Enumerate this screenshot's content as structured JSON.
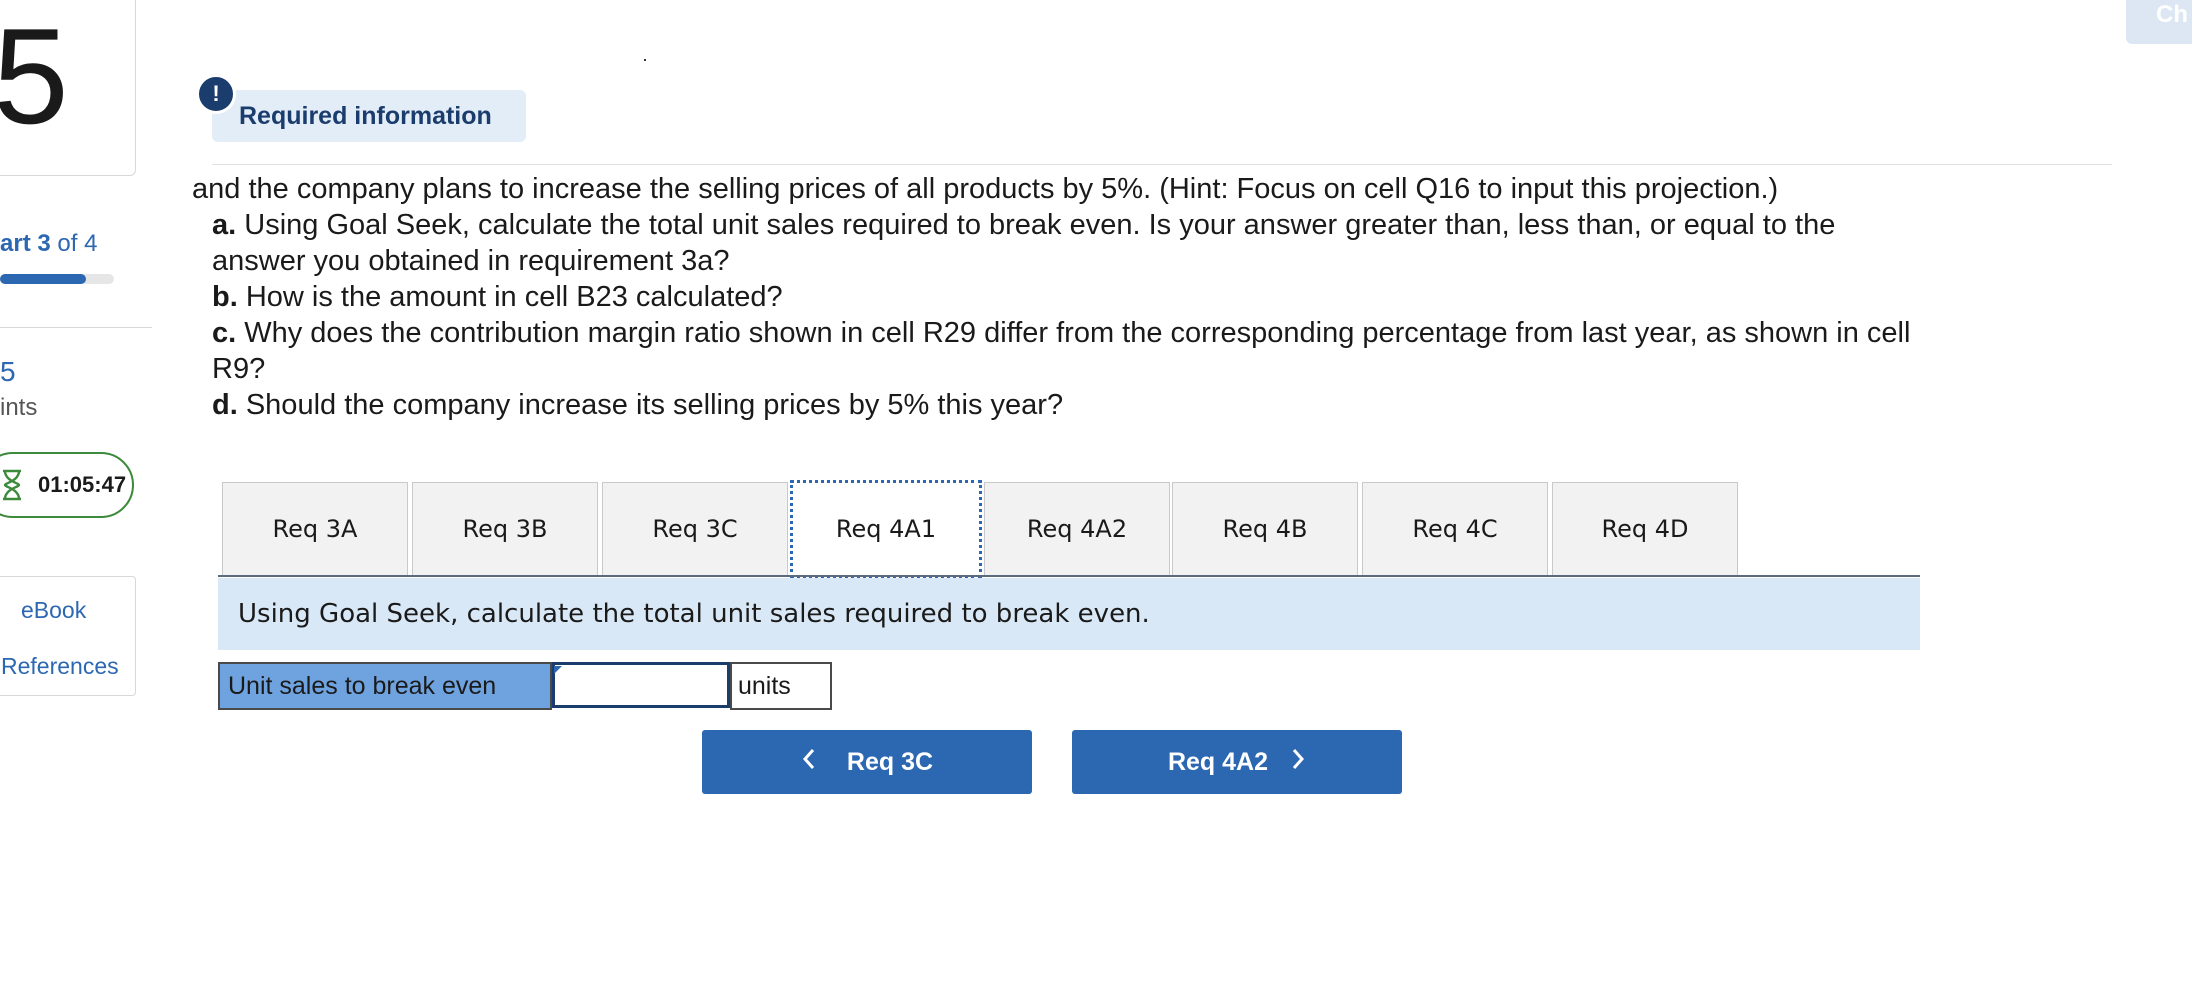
{
  "sidebar": {
    "question_number": "5",
    "part_word": "art",
    "part_current": "3",
    "part_of": "of 4",
    "part_progress": 0.75,
    "points_value": "5",
    "points_label": "ints",
    "timer": "01:05:47",
    "links": [
      "eBook",
      "References"
    ]
  },
  "top_right_button": "Ch",
  "required_info": {
    "icon": "!",
    "label": "Required information"
  },
  "question": {
    "lead": "and the company plans to increase the selling prices of all products by 5%. (Hint: Focus on cell Q16 to input this projection.)",
    "items": [
      {
        "letter": "a.",
        "text": " Using Goal Seek, calculate the total unit sales required to break even. Is your answer greater than, less than, or equal to the",
        "cont": "answer you obtained in requirement 3a?"
      },
      {
        "letter": "b.",
        "text": " How is the amount in cell B23 calculated?",
        "cont": ""
      },
      {
        "letter": "c.",
        "text": " Why does the contribution margin ratio shown in cell R29 differ from the corresponding percentage from last year, as shown in cell",
        "cont": "R9?"
      },
      {
        "letter": "d.",
        "text": " Should the company increase its selling prices by 5% this year?",
        "cont": ""
      }
    ]
  },
  "tabs": [
    {
      "label": "Req 3A"
    },
    {
      "label": "Req 3B"
    },
    {
      "label": "Req 3C"
    },
    {
      "label": "Req 4A1",
      "active": true
    },
    {
      "label": "Req 4A2"
    },
    {
      "label": "Req 4B"
    },
    {
      "label": "Req 4C"
    },
    {
      "label": "Req 4D"
    }
  ],
  "instruction": "Using Goal Seek, calculate the total unit sales required to break even.",
  "answer": {
    "label": "Unit sales to break even",
    "value": "",
    "unit": "units"
  },
  "nav": {
    "prev_label": "Req 3C",
    "next_label": "Req 4A2"
  }
}
